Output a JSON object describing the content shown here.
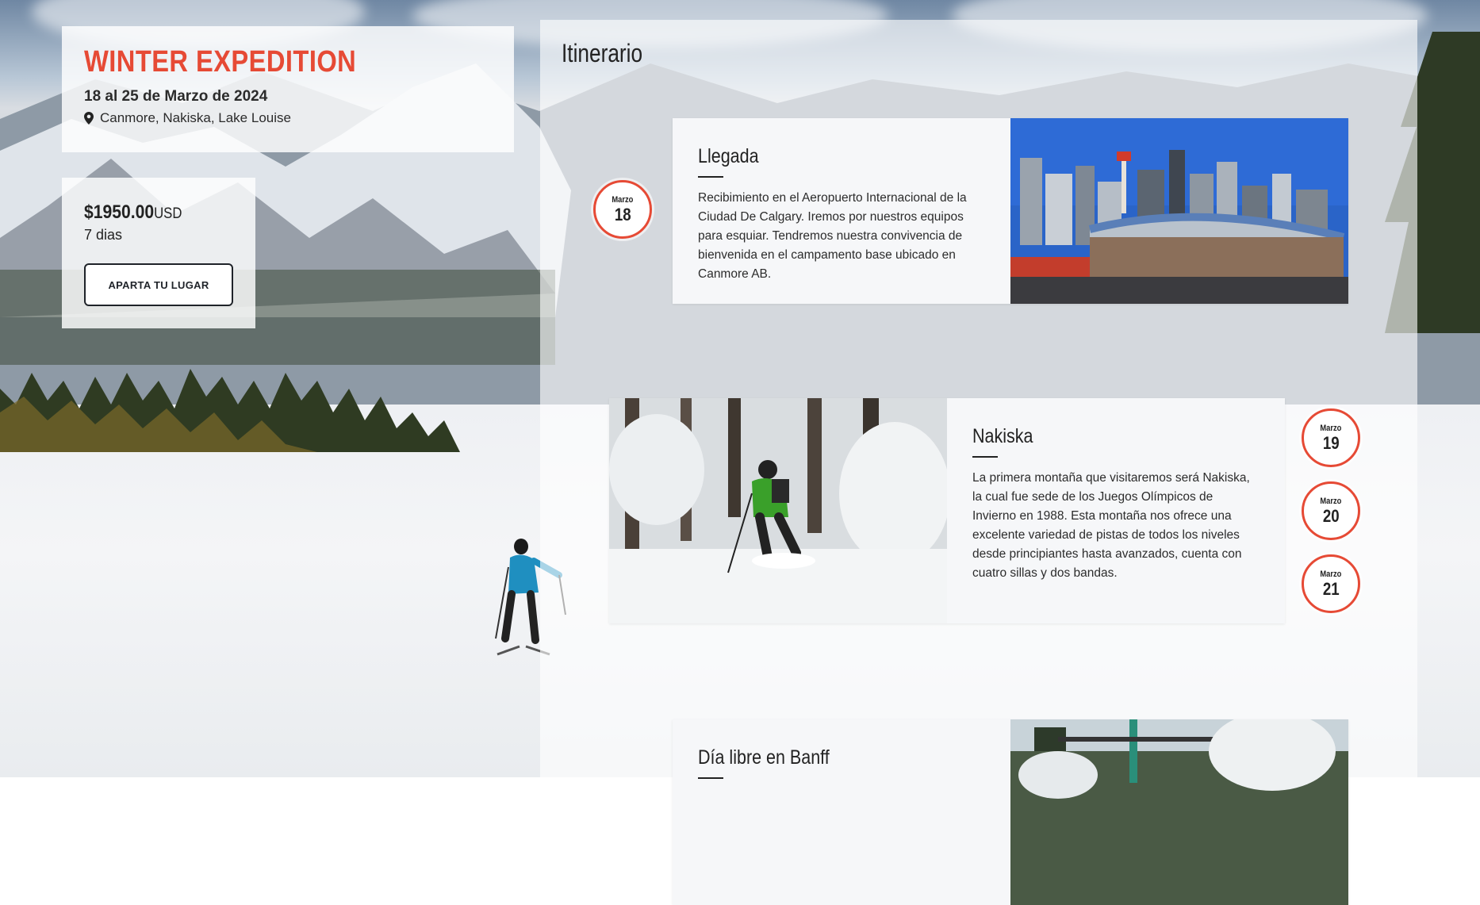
{
  "trip": {
    "title": "WINTER EXPEDITION",
    "dates": "18 al 25 de Marzo de 2024",
    "location": "Canmore, Nakiska, Lake Louise"
  },
  "pricing": {
    "price": "$1950.00",
    "currency": "USD",
    "duration": "7 dias",
    "reserve_label": "APARTA TU LUGAR"
  },
  "itinerary": {
    "title": "Itinerario",
    "days": [
      {
        "title": "Llegada",
        "description": "Recibimiento en el Aeropuerto Internacional de la Ciudad De Calgary. Iremos por nuestros equipos para esquiar. Tendremos nuestra convivencia de bienvenida en el campamento base ubicado en Canmore AB."
      },
      {
        "title": "Nakiska",
        "description": "La primera montaña que visitaremos será Nakiska, la cual fue sede de los Juegos Olímpicos de Invierno en 1988. Esta montaña nos ofrece una excelente variedad de pistas de todos los niveles desde principiantes hasta avanzados, cuenta con cuatro sillas y dos bandas."
      },
      {
        "title": "Día libre en Banff",
        "description": ""
      }
    ],
    "badges": [
      {
        "month": "Marzo",
        "day": "18"
      },
      {
        "month": "Marzo",
        "day": "19"
      },
      {
        "month": "Marzo",
        "day": "20"
      },
      {
        "month": "Marzo",
        "day": "21"
      }
    ]
  },
  "icons": {
    "location": "map-pin-icon"
  },
  "colors": {
    "accent": "#e64a35",
    "text": "#222222",
    "button_border": "#1f2329"
  }
}
